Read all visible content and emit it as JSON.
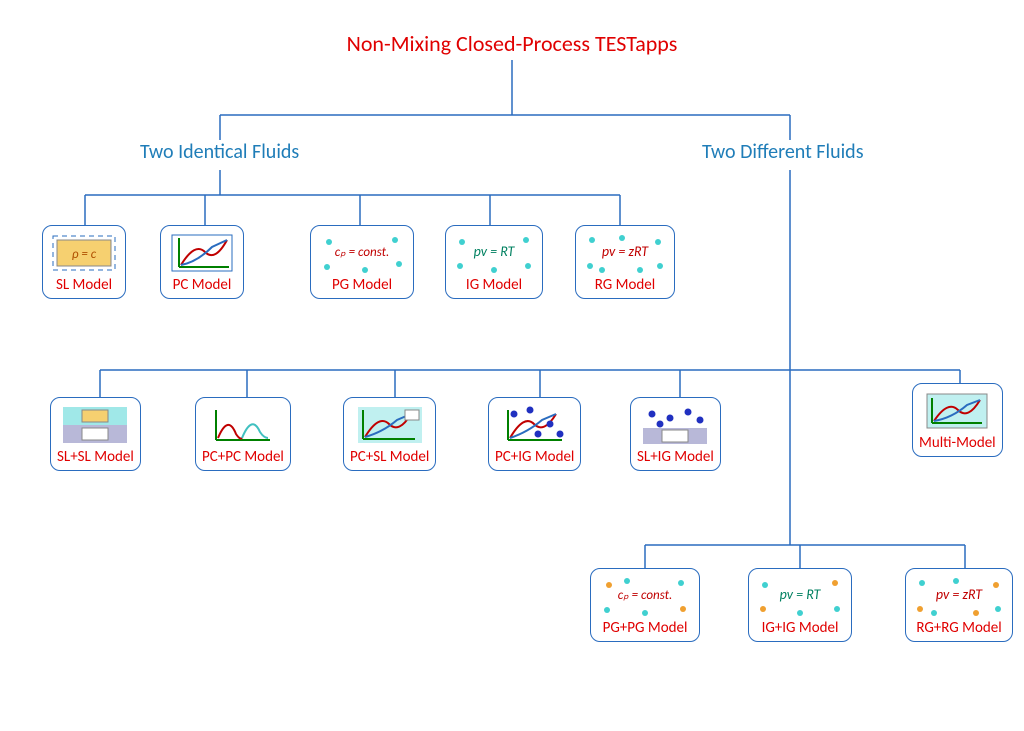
{
  "title": "Non-Mixing Closed-Process TESTapps",
  "categories": {
    "identical": "Two Identical Fluids",
    "different": "Two Different Fluids"
  },
  "models": {
    "sl": "SL Model",
    "pc": "PC Model",
    "pg": "PG Model",
    "ig": "IG Model",
    "rg": "RG Model",
    "multi": "Multi-Model",
    "slsl": "SL+SL Model",
    "pcpc": "PC+PC Model",
    "pcsl": "PC+SL Model",
    "pcig": "PC+IG Model",
    "slig": "SL+IG Model",
    "pgpg": "PG+PG Model",
    "igig": "IG+IG Model",
    "rgrg": "RG+RG Model"
  },
  "formulas": {
    "sl": "ρ = c",
    "pg": "cₚ = const.",
    "ig": "pv = RT",
    "rg": "pv = zRT"
  }
}
